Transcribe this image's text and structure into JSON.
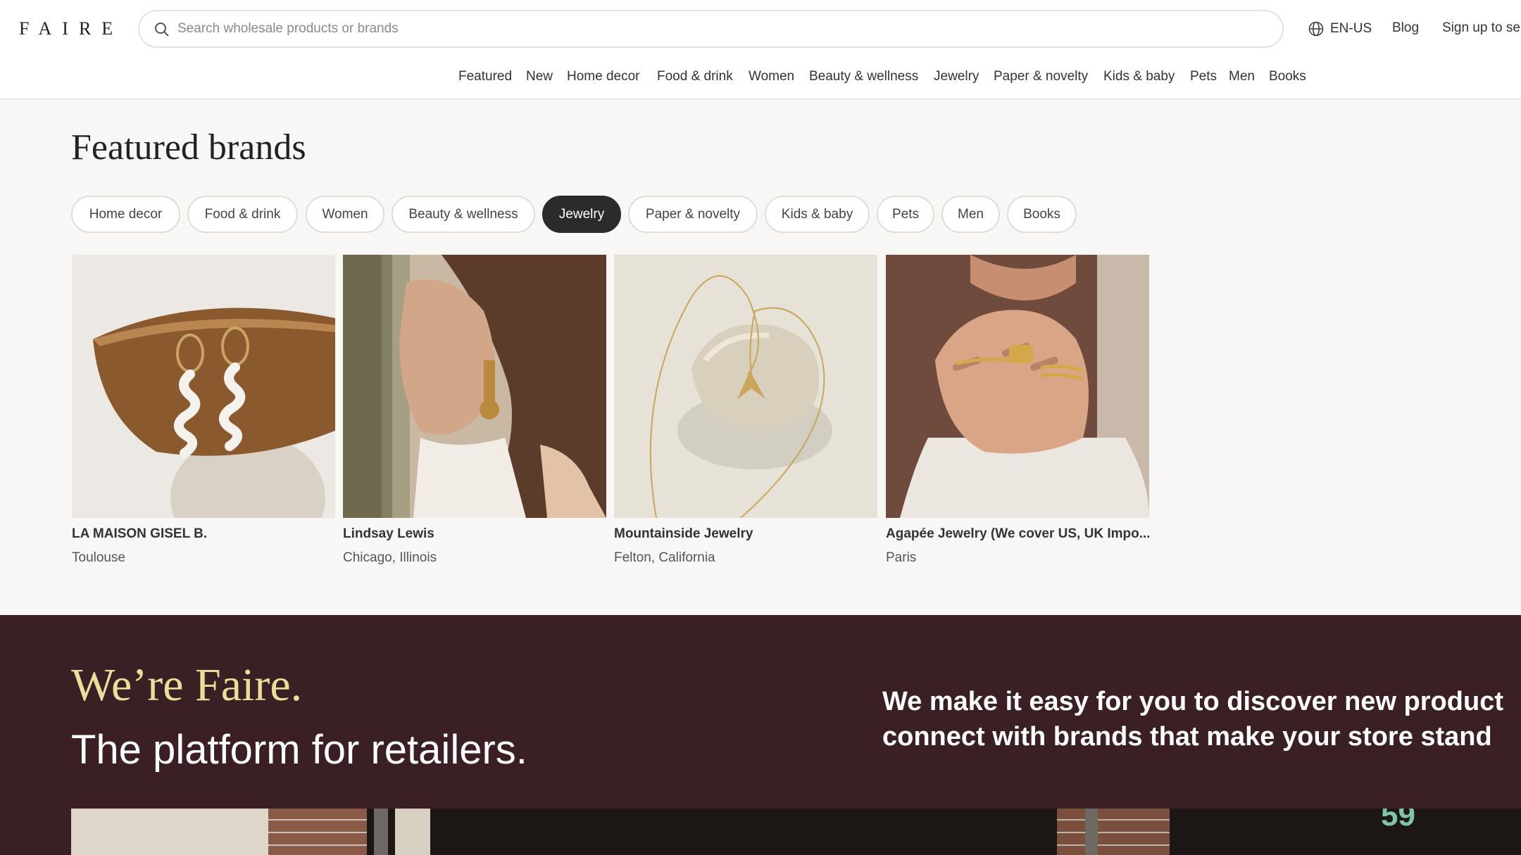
{
  "header": {
    "logo": "FAIRE",
    "search_placeholder": "Search wholesale products or brands",
    "language": "EN-US",
    "blog": "Blog",
    "signup": "Sign up to se"
  },
  "nav": {
    "items": [
      "Featured",
      "New",
      "Home decor",
      "Food & drink",
      "Women",
      "Beauty & wellness",
      "Jewelry",
      "Paper & novelty",
      "Kids & baby",
      "Pets",
      "Men",
      "Books"
    ]
  },
  "featured": {
    "title": "Featured brands",
    "chips": [
      "Home decor",
      "Food & drink",
      "Women",
      "Beauty & wellness",
      "Jewelry",
      "Paper & novelty",
      "Kids & baby",
      "Pets",
      "Men",
      "Books"
    ],
    "active_chip": "Jewelry",
    "brands": [
      {
        "name": "LA MAISON GISEL B.",
        "location": "Toulouse"
      },
      {
        "name": "Lindsay Lewis",
        "location": "Chicago, Illinois"
      },
      {
        "name": "Mountainside Jewelry",
        "location": "Felton, California"
      },
      {
        "name": "Agapée Jewelry (We cover US, UK Impo...",
        "location": "Paris"
      }
    ]
  },
  "about": {
    "title": "We’re Faire.",
    "subtitle": "The platform for retailers.",
    "line1": "We make it easy for you to discover new product",
    "line2": "connect with brands that make your store stand",
    "storefront_number": "59"
  },
  "colors": {
    "dark_section": "#3a1f24",
    "accent_yellow": "#e9df9b",
    "chip_active": "#2b2b2b",
    "featured_bg": "#f9f7f5"
  }
}
